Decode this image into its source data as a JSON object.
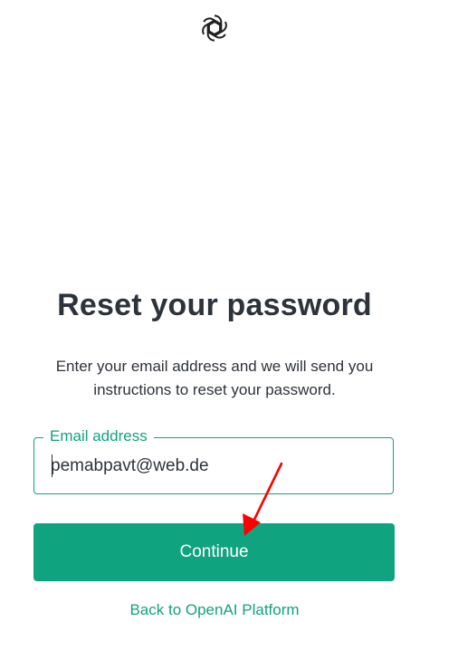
{
  "header": {
    "logo_icon": "openai-logo-icon"
  },
  "main": {
    "title": "Reset your password",
    "description": "Enter your email address and we will send you instructions to reset your password.",
    "email_field": {
      "label": "Email address",
      "value": "pemabpavt@web.de"
    },
    "continue_label": "Continue",
    "back_link_label": "Back to OpenAI Platform"
  },
  "annotation": {
    "arrow_icon": "red-arrow-icon",
    "arrow_color": "#ff0000"
  },
  "colors": {
    "accent": "#10a37f",
    "text": "#2d333a",
    "background": "#ffffff"
  }
}
